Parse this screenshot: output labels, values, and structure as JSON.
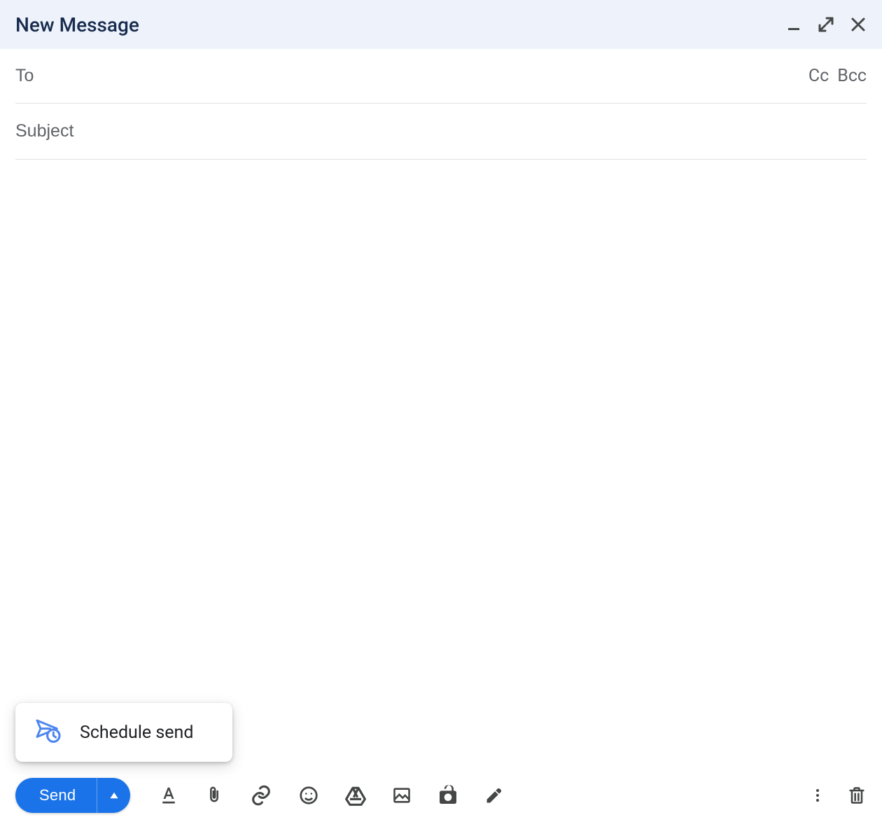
{
  "header": {
    "title": "New Message"
  },
  "fields": {
    "to_placeholder": "To",
    "cc_label": "Cc",
    "bcc_label": "Bcc",
    "subject_placeholder": "Subject"
  },
  "popup": {
    "schedule_send_label": "Schedule send"
  },
  "toolbar": {
    "send_label": "Send"
  },
  "colors": {
    "primary": "#1a73e8",
    "muted": "#5f6368",
    "icon": "#444746"
  }
}
